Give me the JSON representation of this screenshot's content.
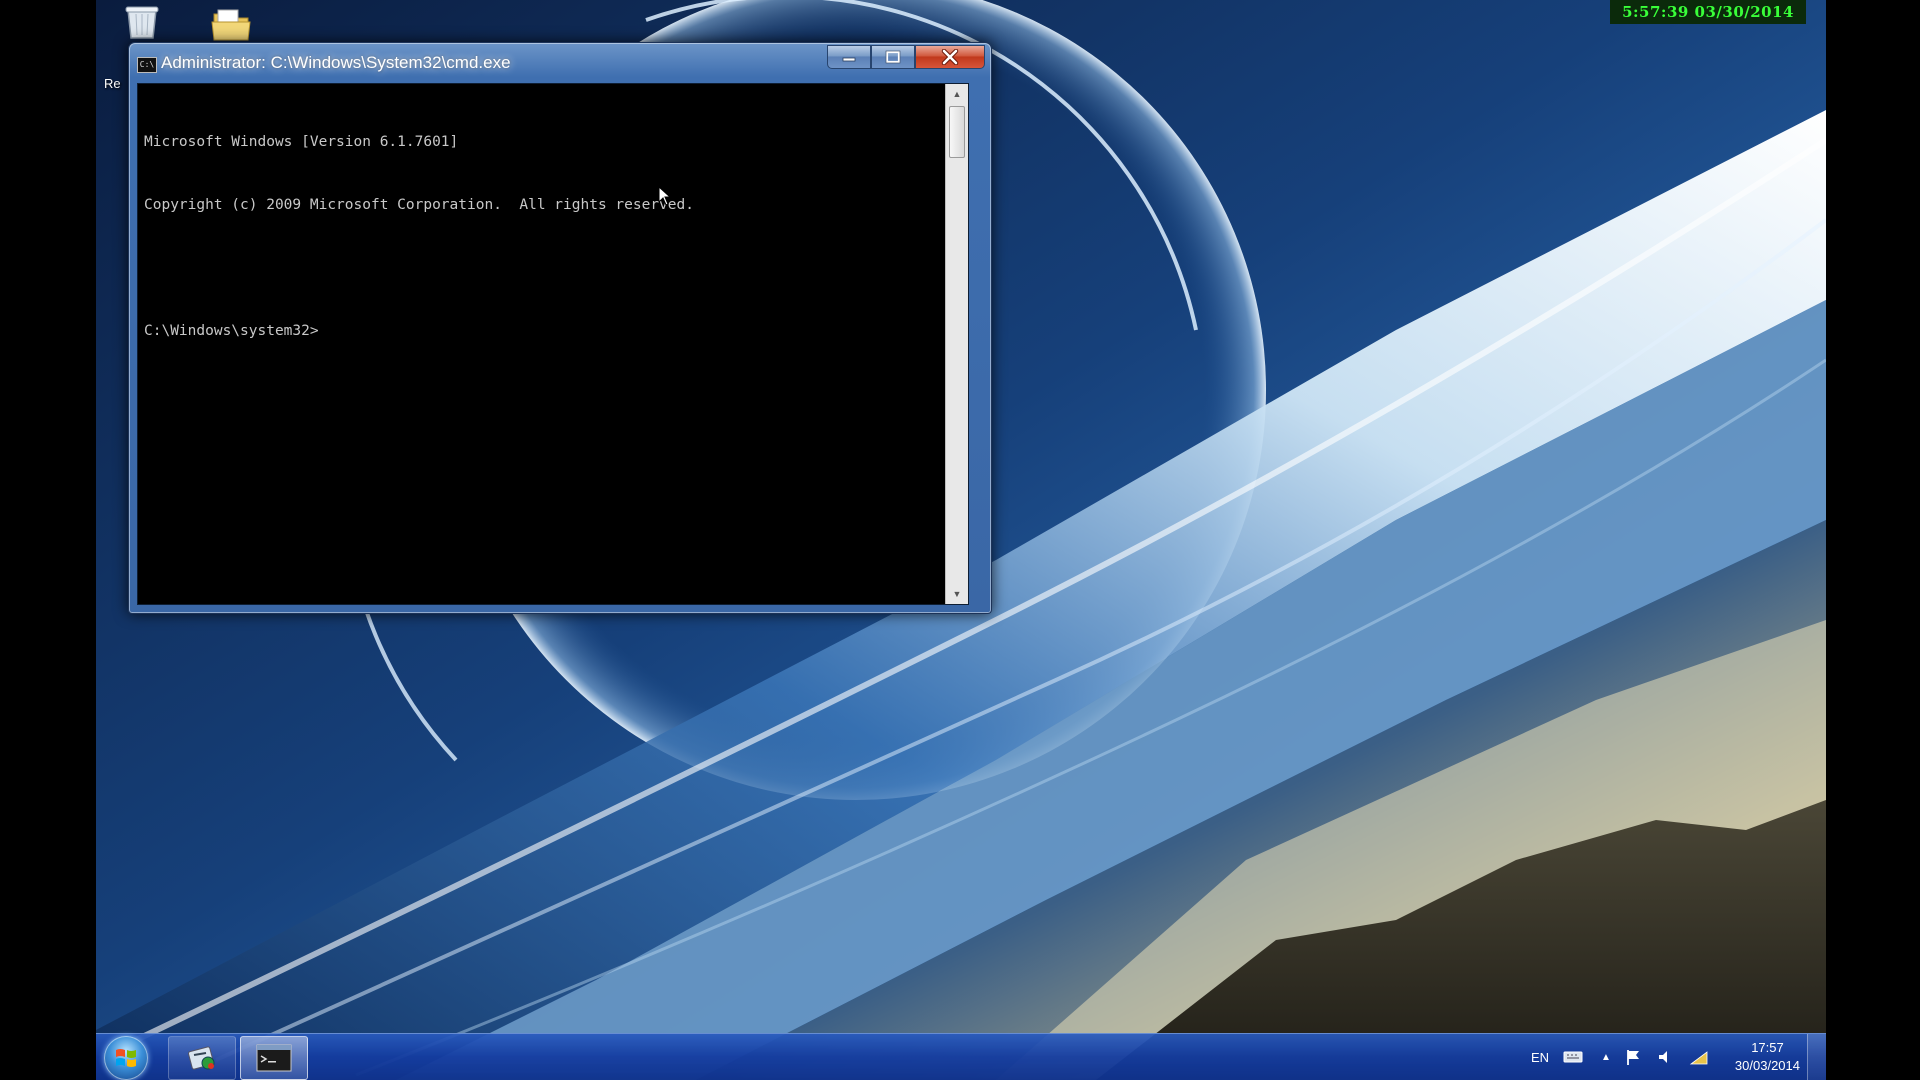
{
  "recorder_overlay": {
    "timestamp": "5:57:39  03/30/2014"
  },
  "desktop": {
    "icons": [
      {
        "icon": "recycle-bin-icon",
        "label": "Re"
      },
      {
        "icon": "folder-icon",
        "label": ""
      }
    ]
  },
  "cmd_window": {
    "title": "Administrator: C:\\Windows\\System32\\cmd.exe",
    "console_lines": [
      "Microsoft Windows [Version 6.1.7601]",
      "Copyright (c) 2009 Microsoft Corporation.  All rights reserved.",
      "",
      "C:\\Windows\\system32>"
    ],
    "controls": [
      "minimize",
      "maximize",
      "close"
    ]
  },
  "taskbar": {
    "start_button": "windows-start-icon",
    "pinned_items": [
      {
        "icon": "settings-tool-icon"
      },
      {
        "icon": "cmd-icon",
        "active": true
      }
    ],
    "tray": {
      "language": "EN",
      "icons": [
        "keyboard-icon",
        "show-hidden-icons-arrow",
        "action-center-flag-icon",
        "volume-icon",
        "network-icon"
      ],
      "time": "17:57",
      "date": "30/03/2014"
    }
  },
  "colors": {
    "recorder_text": "#39ff39",
    "console_text": "#c8c8c8",
    "console_bg": "#000000",
    "window_frame": "#3f6fb0",
    "close_button": "#c0391c"
  }
}
